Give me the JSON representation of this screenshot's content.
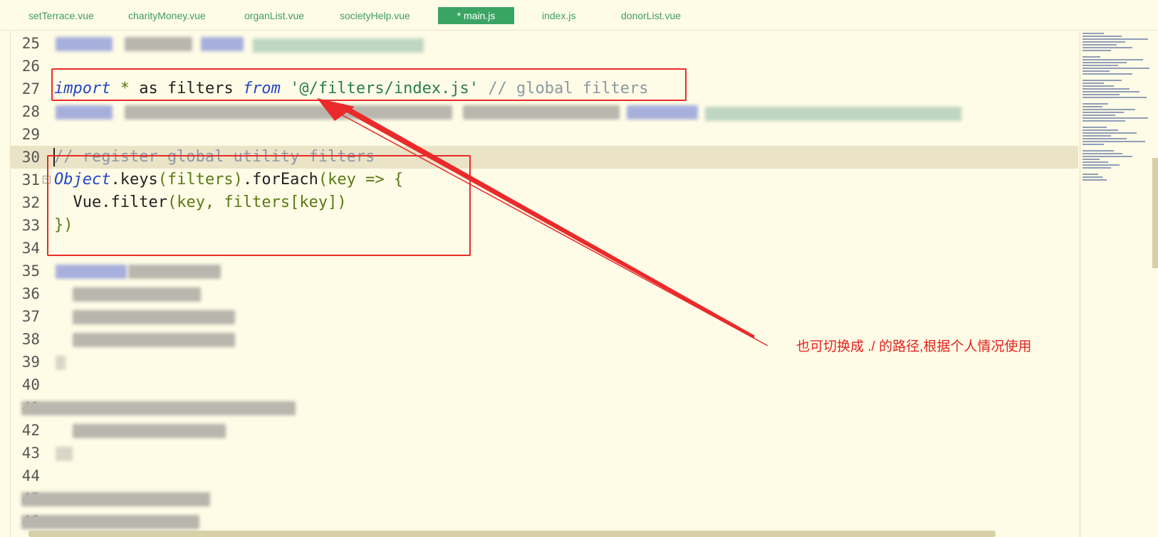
{
  "tabs": [
    {
      "label": "setTerrace.vue",
      "active": false
    },
    {
      "label": "charityMoney.vue",
      "active": false
    },
    {
      "label": "organList.vue",
      "active": false
    },
    {
      "label": "societyHelp.vue",
      "active": false
    },
    {
      "label": "* main.js",
      "active": true
    },
    {
      "label": "index.js",
      "active": false
    },
    {
      "label": "donorList.vue",
      "active": false
    }
  ],
  "line_numbers": [
    "25",
    "26",
    "27",
    "28",
    "29",
    "30",
    "31",
    "32",
    "33",
    "34",
    "35",
    "36",
    "37",
    "38",
    "39",
    "40",
    "41",
    "42",
    "43",
    "44",
    "45",
    "46"
  ],
  "code": {
    "import_kw": "import",
    "import_star": " * ",
    "import_as": "as filters ",
    "import_from": "from",
    "import_path": " '@/filters/index.js'",
    "import_comment": " // global filters",
    "comment_register": "// register global utility filters",
    "object_cls": "Object",
    "keys_call": ".keys",
    "keys_args": "(filters)",
    "foreach_call": ".forEach",
    "foreach_open": "(key => {",
    "vue_filter": "  Vue.filter",
    "vue_filter_args": "(key, filters[key])",
    "close_brace": "})"
  },
  "annotation": {
    "text": "也可切换成 ./ 的路径,根据个人情况使用"
  },
  "colors": {
    "annotation_red": "#ea2a2a",
    "tab_active_bg": "#3aa464",
    "tab_text": "#3f9d5f",
    "editor_bg": "#fefbe6",
    "keyword": "#2447c9",
    "string": "#297d55",
    "comment": "#8b9aa5"
  }
}
